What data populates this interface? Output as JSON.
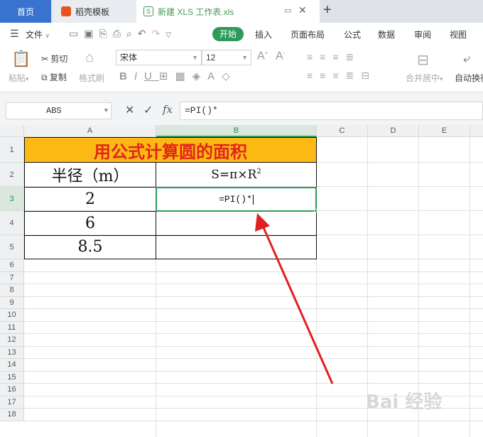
{
  "tabs": {
    "home": "首页",
    "daoke": "稻壳模板",
    "file": "新建 XLS 工作表.xls",
    "add": "+"
  },
  "menu": {
    "file": "文件",
    "items": [
      "开始",
      "插入",
      "页面布局",
      "公式",
      "数据",
      "审阅",
      "视图"
    ]
  },
  "ribbon": {
    "paste": "粘贴",
    "cut": "剪切",
    "copy": "复制",
    "format_painter": "格式刷",
    "font_name": "宋体",
    "font_size": "12",
    "merge_center": "合并居中",
    "auto_wrap": "自动换行"
  },
  "formula_bar": {
    "name_box": "ABS",
    "fx": "fx",
    "formula": "=PI()*"
  },
  "columns": [
    "A",
    "B",
    "C",
    "D",
    "E"
  ],
  "rows": [
    "1",
    "2",
    "3",
    "4",
    "5",
    "6",
    "7",
    "8",
    "9",
    "10",
    "11",
    "12",
    "13",
    "14",
    "15",
    "16",
    "17",
    "18"
  ],
  "sheet": {
    "title": "用公式计算圆的面积",
    "header_a": "半径（m）",
    "header_b": "S=π×R",
    "header_b_sup": "2",
    "a3": "2",
    "a4": "6",
    "a5": "8.5",
    "b3": "=PI()*"
  },
  "watermark": "Bai 经验",
  "colors": {
    "accent": "#2d9a5b",
    "title_fill": "#fdb913",
    "title_text": "#e0261c",
    "home_tab": "#3a73cf",
    "arrow": "#e02020"
  }
}
